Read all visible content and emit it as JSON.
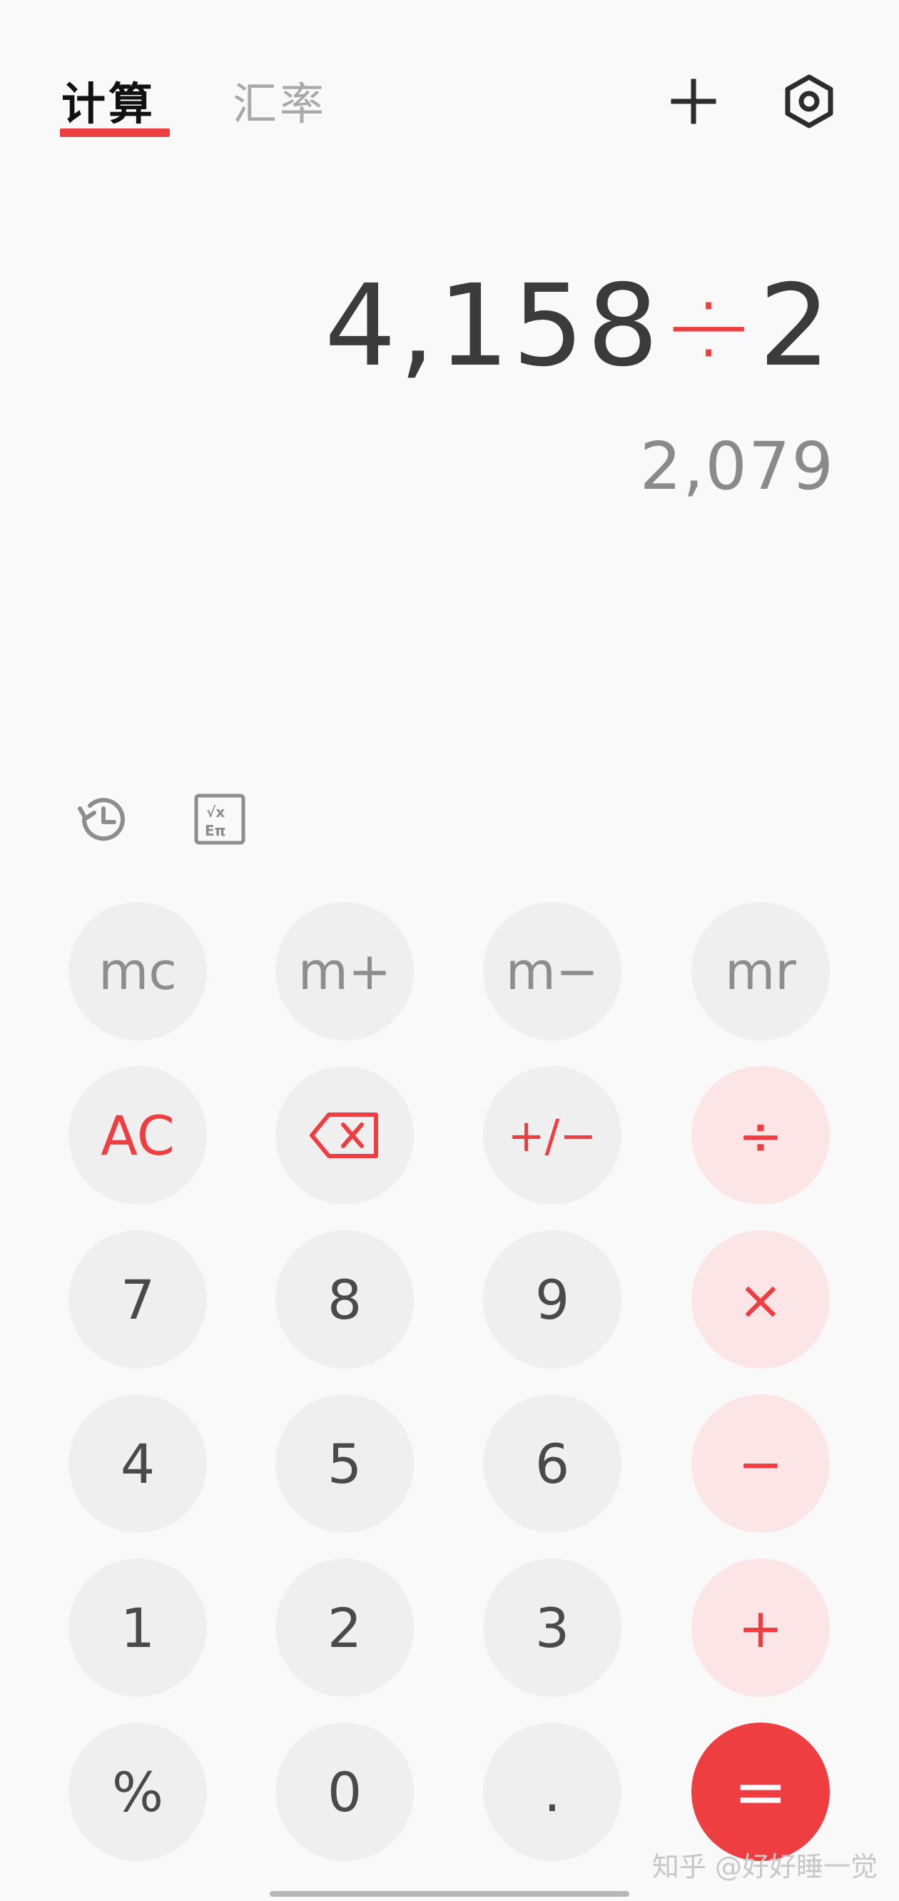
{
  "tabs": {
    "calc_label": "计算",
    "rate_label": "汇率"
  },
  "display": {
    "operand1": "4,158",
    "operator": "÷",
    "operand2": "2",
    "result": "2,079"
  },
  "icons": {
    "collapse": "collapse-icon",
    "settings": "settings-icon",
    "history": "history-icon",
    "scientific": "scientific-mode-icon"
  },
  "keys": {
    "mc": "mc",
    "mplus": "m+",
    "mminus": "m−",
    "mr": "mr",
    "ac": "AC",
    "plusminus": "+/−",
    "divide": "÷",
    "seven": "7",
    "eight": "8",
    "nine": "9",
    "multiply": "×",
    "four": "4",
    "five": "5",
    "six": "6",
    "minus": "−",
    "one": "1",
    "two": "2",
    "three": "3",
    "plus": "+",
    "percent": "%",
    "zero": "0",
    "decimal": ".",
    "equals": "="
  },
  "watermark": "知乎 @好好睡一觉",
  "colors": {
    "accent": "#ef3e42",
    "key_bg": "#efefef",
    "op_key_bg": "#fbe5e6",
    "background": "#f9f9f9"
  }
}
